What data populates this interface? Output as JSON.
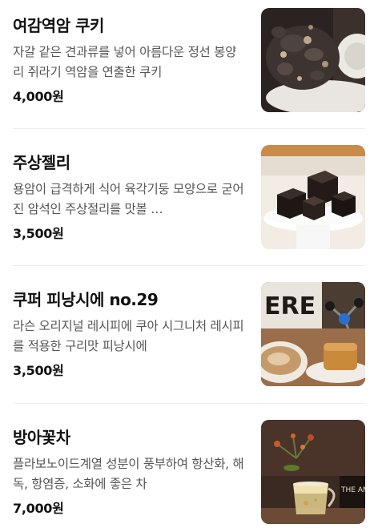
{
  "menu": {
    "items": [
      {
        "name": "여감역암 쿠키",
        "description": "자갈 같은 견과류를 넣어 아름다운 정선 봉양리 쥐라기 역암을 연출한 쿠키",
        "price": "4,000원",
        "image_icon": "cookie-photo"
      },
      {
        "name": "주상젤리",
        "description": "용암이 급격하게 식어 육각기둥 모양으로 굳어진 암석인 주상절리를 맛볼 …",
        "price": "3,500원",
        "image_icon": "jelly-photo"
      },
      {
        "name": "쿠퍼 피낭시에 no.29",
        "description": "라슨 오리지널 레시피에 쿠아 시그니처 레시피를 적용한 구리맛 피낭시에",
        "price": "3,500원",
        "image_icon": "financier-photo",
        "photo_sign_text": "ERE"
      },
      {
        "name": "방아꽃차",
        "description": "플라보노이드계열 성분이 풍부하여 항산화, 해독, 항염증, 소화에 좋은 차",
        "price": "7,000원",
        "image_icon": "flower-tea-photo",
        "photo_book_text": "THE ANSW"
      }
    ]
  }
}
